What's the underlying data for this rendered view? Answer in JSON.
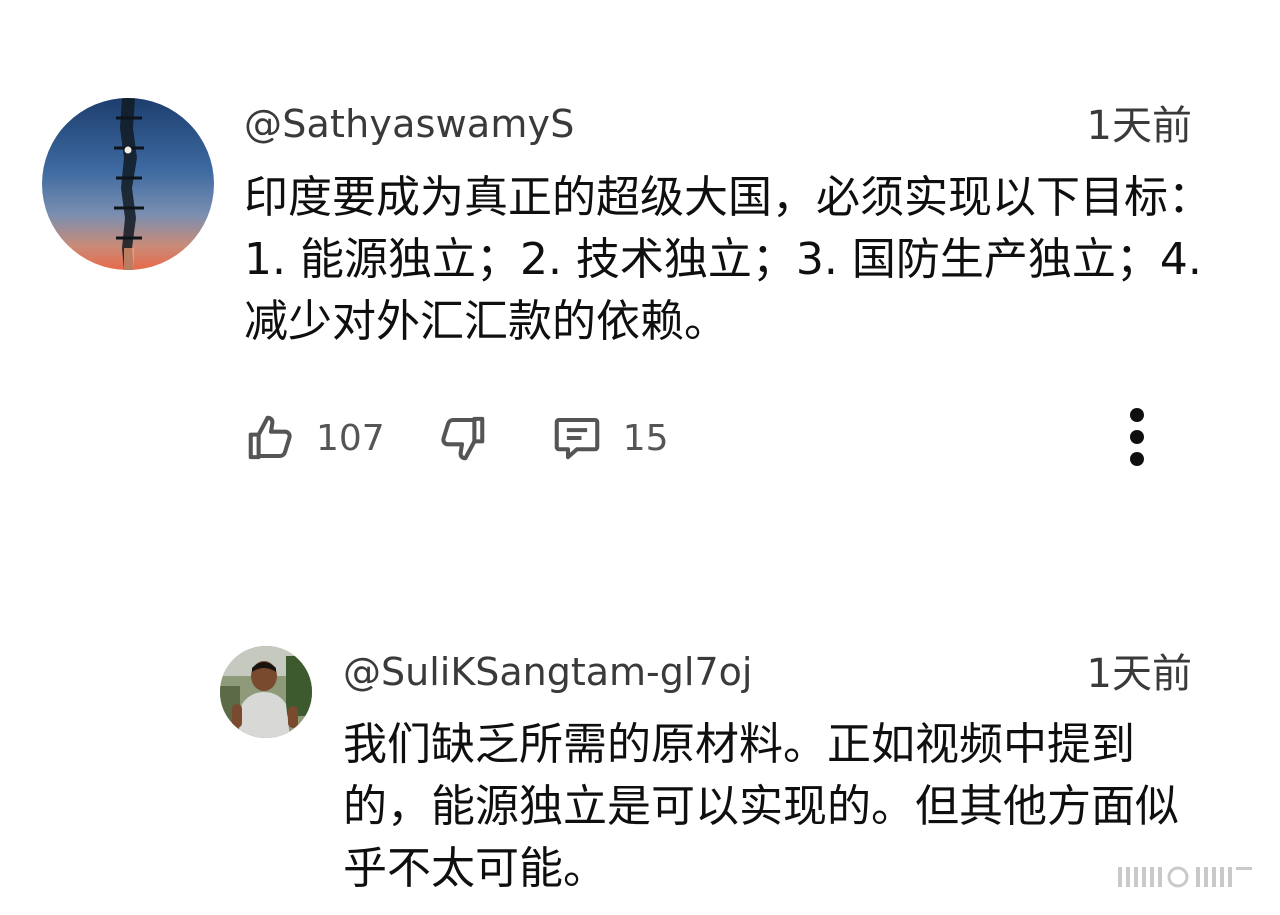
{
  "comment": {
    "username": "@SathyaswamyS",
    "timestamp": "1天前",
    "text": "印度要成为真正的超级大国，必须实现以下目标：1. 能源独立；2. 技术独立；3. 国防生产独立；4. 减少对外汇汇款的依赖。",
    "likes": "107",
    "replies": "15",
    "icons": {
      "like": "thumb-up-icon",
      "dislike": "thumb-down-icon",
      "reply": "comment-icon",
      "more": "more-vertical-icon"
    }
  },
  "reply": {
    "username": "@SuliKSangtam-gl7oj",
    "timestamp": "1天前",
    "text": "我们缺乏所需的原材料。正如视频中提到的，能源独立是可以实现的。但其他方面似乎不太可能。"
  },
  "colors": {
    "text_primary": "#0f0f0f",
    "text_secondary": "#3a3a3a",
    "icon": "#555555",
    "background": "#ffffff"
  }
}
